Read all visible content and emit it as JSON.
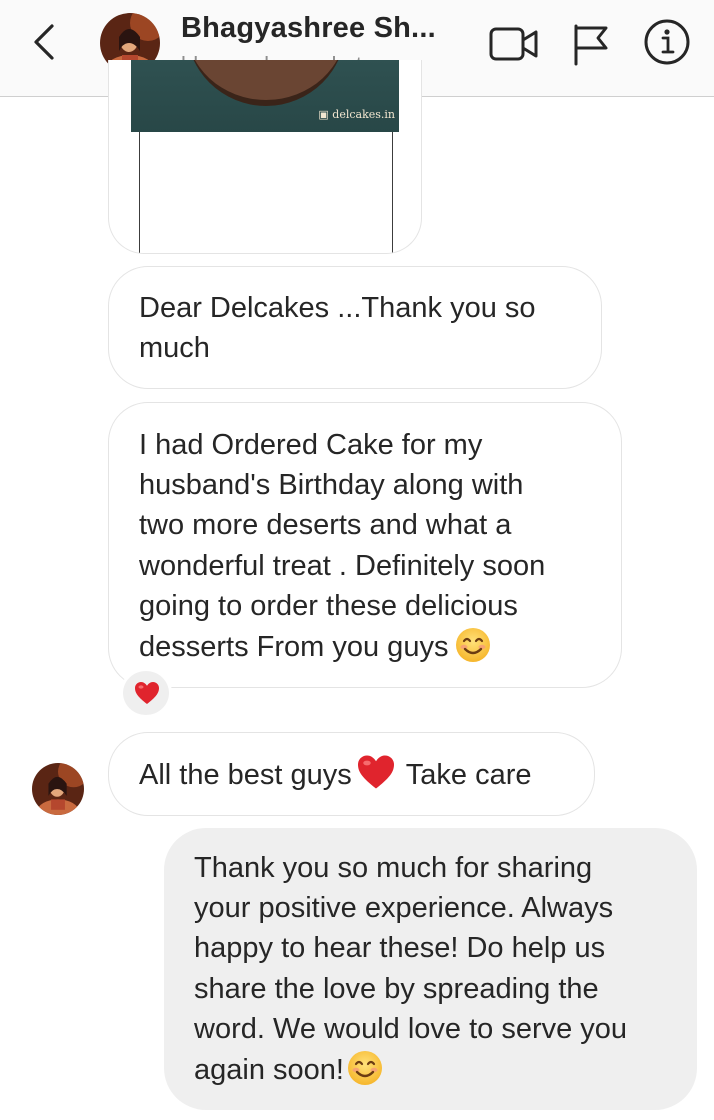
{
  "header": {
    "display_name": "Bhagyashree Sh...",
    "username": "bhagyashree_shetye",
    "icons": [
      "chevron-left-icon",
      "video-call-icon",
      "flag-icon",
      "info-icon"
    ]
  },
  "shared_post": {
    "watermark": "delcakes.in"
  },
  "messages": [
    {
      "id": "m1",
      "sender": "them",
      "text": "Dear Delcakes  ...Thank you so\nmuch"
    },
    {
      "id": "m2",
      "sender": "them",
      "text": "I had Ordered Cake for my\nhusband's Birthday along with\ntwo more deserts and what a\nwonderful treat . Definitely soon\ngoing to order these delicious\ndesserts From you guys",
      "trailing_emoji": "smiling-face-emoji",
      "reaction": "red-heart-emoji"
    },
    {
      "id": "m3",
      "sender": "them",
      "text_before": "All the best guys",
      "inline_emoji": "red-heart-emoji",
      "text_after": "Take care"
    },
    {
      "id": "m4",
      "sender": "me",
      "text": "Thank you so much for sharing\nyour positive experience. Always\nhappy to hear these! Do help us\nshare the love by spreading the\nword. We would love to serve you\nagain soon!",
      "trailing_emoji": "smiling-face-emoji"
    }
  ],
  "colors": {
    "header_bg": "#fafafa",
    "outgoing_bubble": "#efefef",
    "incoming_border": "#e4e4e4",
    "text": "#262626",
    "secondary_text": "#8e8e8e",
    "heart": "#e0242d"
  }
}
